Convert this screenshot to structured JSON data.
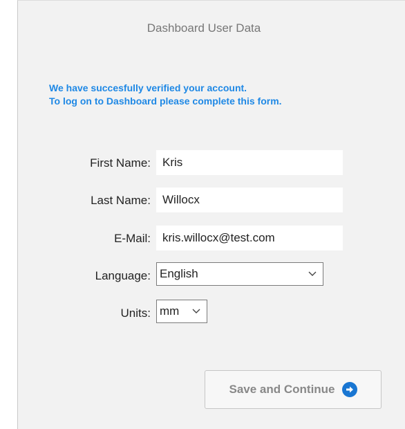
{
  "form": {
    "title": "Dashboard User Data",
    "intro_line1": "We have succesfully verified your account.",
    "intro_line2": "To log on to Dashboard please complete this form.",
    "first_name_label": "First Name:",
    "first_name_value": "Kris",
    "last_name_label": "Last Name:",
    "last_name_value": "Willocx",
    "email_label": "E-Mail:",
    "email_value": "kris.willocx@test.com",
    "language_label": "Language:",
    "language_value": "English",
    "units_label": "Units:",
    "units_value": "mm",
    "save_label": "Save and Continue"
  },
  "icons": {
    "select_chevron": "chevron-down-icon",
    "save_button_icon": "arrow-right-circle-icon"
  },
  "colors": {
    "accent": "#1e88e5",
    "button_icon": "#1976d2",
    "panel_bg": "#f2f2f2"
  }
}
